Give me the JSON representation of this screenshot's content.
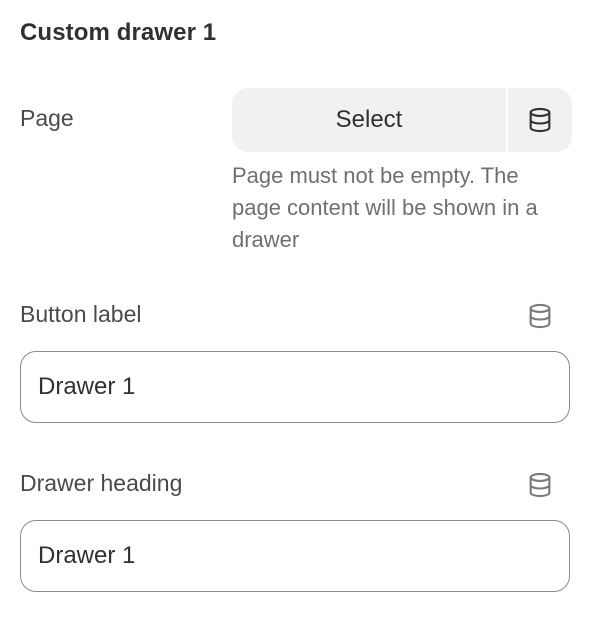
{
  "section": {
    "title": "Custom drawer 1"
  },
  "page_field": {
    "label": "Page",
    "select_label": "Select",
    "source_icon": "database-icon",
    "help_text": "Page must not be empty. The page content will be shown in a drawer"
  },
  "button_label_field": {
    "label": "Button label",
    "value": "Drawer 1",
    "source_icon": "database-icon"
  },
  "drawer_heading_field": {
    "label": "Drawer heading",
    "value": "Drawer 1",
    "source_icon": "database-icon"
  },
  "colors": {
    "text": "#303030",
    "muted": "#707070",
    "button_bg": "#f1f1f1",
    "input_border": "#8a8a8a"
  }
}
